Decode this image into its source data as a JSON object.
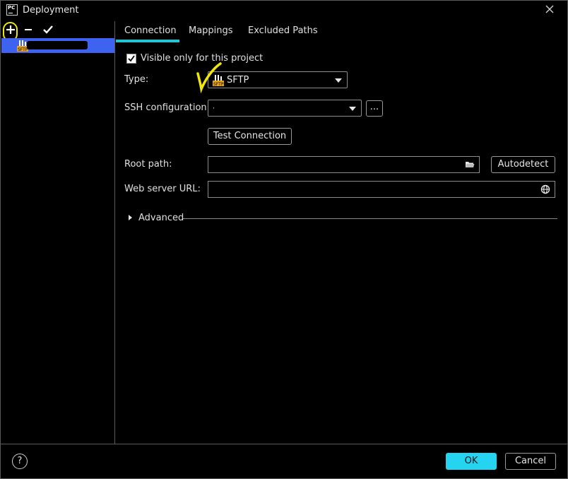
{
  "window": {
    "title": "Deployment",
    "app_icon_text": "PC"
  },
  "toolbar": {
    "add": "+",
    "remove": "−",
    "apply": "✔"
  },
  "servers": [
    {
      "type_label": "SFTP",
      "name": "",
      "selected": true
    }
  ],
  "tabs": [
    {
      "label": "Connection",
      "active": true
    },
    {
      "label": "Mappings",
      "active": false
    },
    {
      "label": "Excluded Paths",
      "active": false
    }
  ],
  "form": {
    "visible_only_label": "Visible only for this project",
    "visible_only_checked": true,
    "type_label": "Type:",
    "type_value": "SFTP",
    "ssh_label": "SSH configuration:",
    "ssh_value": ",",
    "browse_label": "...",
    "test_connection": "Test Connection",
    "root_path_label": "Root path:",
    "root_path_value": "",
    "autodetect": "Autodetect",
    "web_url_label": "Web server URL:",
    "web_url_value": "",
    "advanced_label": "Advanced"
  },
  "footer": {
    "help": "?",
    "ok": "OK",
    "cancel": "Cancel"
  },
  "colors": {
    "accent": "#25c4d4",
    "selection": "#3d63f0",
    "annotation": "#f0e60a",
    "ok_button": "#25d4f0"
  },
  "icons": [
    "app-icon",
    "close-icon",
    "plus-icon",
    "minus-icon",
    "check-icon",
    "sftp-icon",
    "dropdown-arrow-icon",
    "folder-icon",
    "globe-icon",
    "expand-arrow-icon",
    "help-icon"
  ]
}
